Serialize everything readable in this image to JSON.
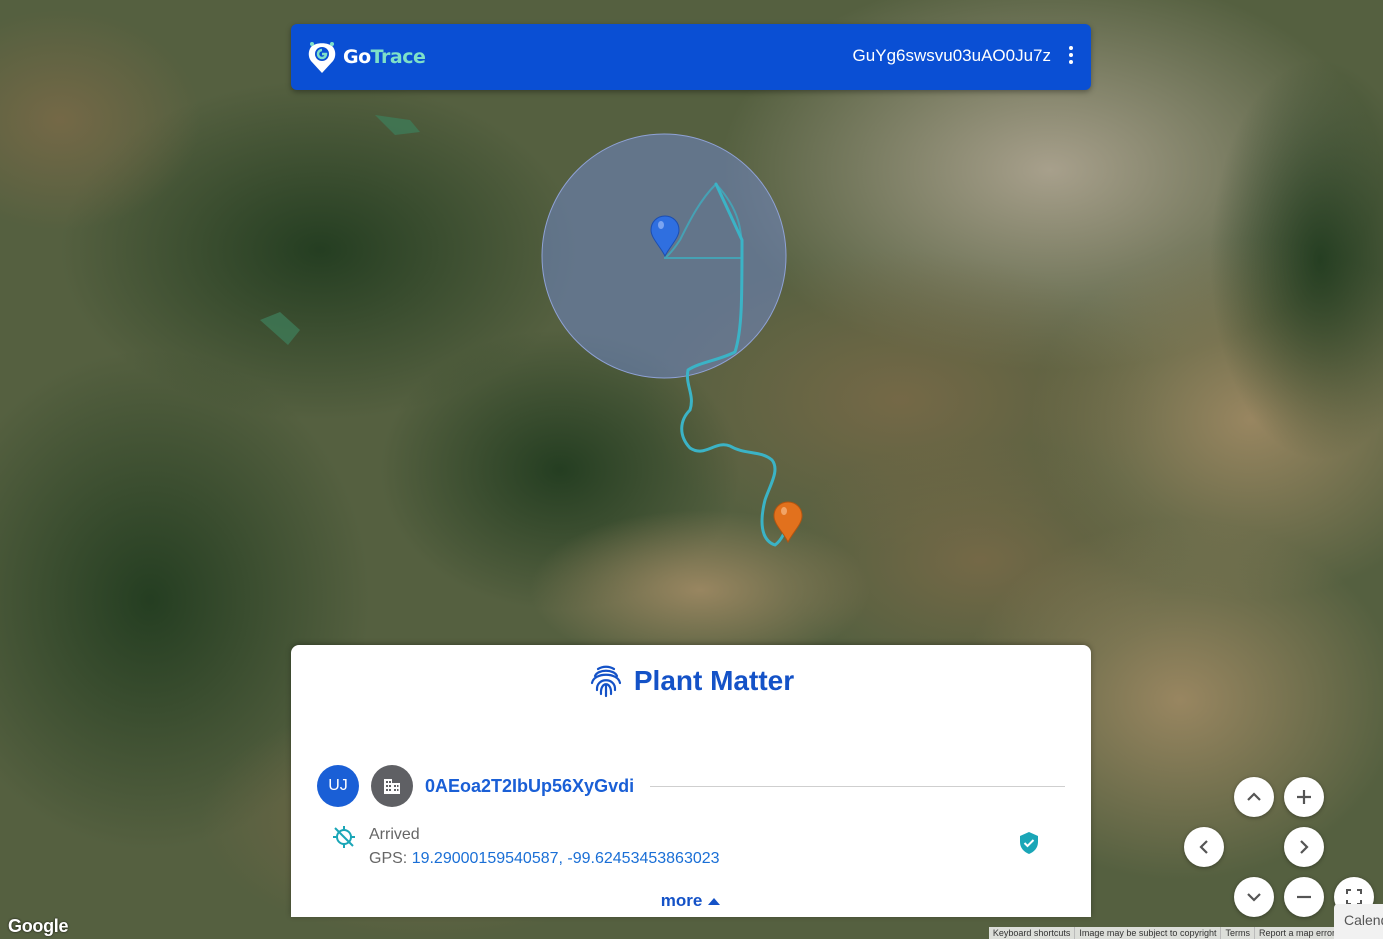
{
  "header": {
    "logo_go": "Go",
    "logo_trace": "Trace",
    "tracking_id": "GuYg6swsvu03uAO0Ju7z"
  },
  "panel": {
    "title": "Plant Matter",
    "avatar_initials": "UJ",
    "entity_id": "0AEoa2T2IbUp56XyGvdi",
    "status": "Arrived",
    "gps_label": "GPS: ",
    "gps_value": "19.29000159540587, -99.62453453863023",
    "more_label": "more"
  },
  "map": {
    "google_label": "Google",
    "attribution": {
      "shortcuts": "Keyboard shortcuts",
      "copyright": "Image may be subject to copyright",
      "terms": "Terms",
      "report": "Report a map error"
    },
    "calendar_tab": "Calendar"
  },
  "colors": {
    "brand_blue": "#0a4fd4",
    "route": "#3bb3c6",
    "start_marker": "#2f6fe0",
    "end_marker": "#e2711d",
    "verified": "#1aa6b7"
  }
}
